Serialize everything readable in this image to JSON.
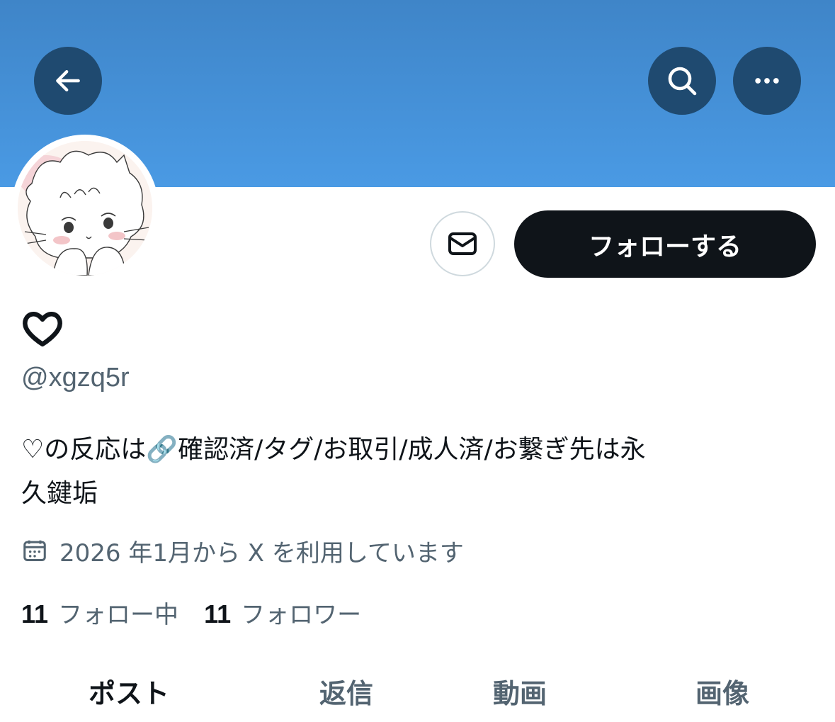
{
  "header": {
    "back_icon": "arrow-left-icon",
    "search_icon": "search-icon",
    "more_icon": "more-horizontal-icon",
    "banner_color": "#4a9ae4"
  },
  "profile": {
    "avatar": "cartoon-cat-avatar",
    "display_name_icon": "heart-outline-icon",
    "handle": "@xgzq5r",
    "bio_line1": "♡の反応は🔗確認済/タグ/お取引/成人済/お繋ぎ先は永",
    "bio_line2": "久鍵垢",
    "joined": "2026 年1月から X を利用しています",
    "joined_icon": "calendar-icon"
  },
  "actions": {
    "message_icon": "mail-icon",
    "follow_label": "フォローする"
  },
  "stats": {
    "following_count": "11",
    "following_label": "フォロー中",
    "followers_count": "11",
    "followers_label": "フォロワー"
  },
  "tabs": [
    {
      "label": "ポスト",
      "active": true
    },
    {
      "label": "返信",
      "active": false
    },
    {
      "label": "動画",
      "active": false
    },
    {
      "label": "画像",
      "active": false
    }
  ],
  "colors": {
    "primary_text": "#0f1419",
    "secondary_text": "#536471",
    "header_button": "#1f4a70"
  }
}
